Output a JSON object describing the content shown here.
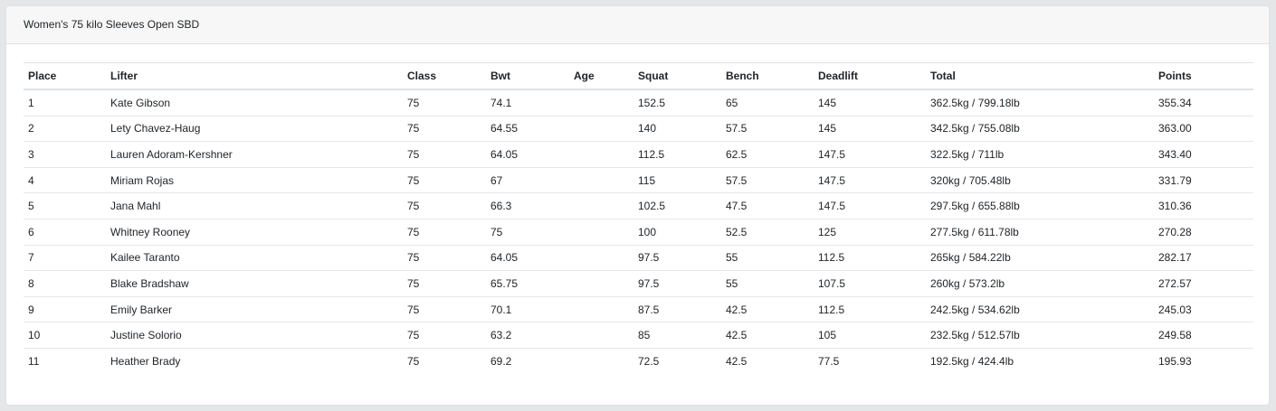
{
  "card": {
    "title": "Women's 75 kilo Sleeves Open SBD"
  },
  "table": {
    "headers": {
      "place": "Place",
      "lifter": "Lifter",
      "class": "Class",
      "bwt": "Bwt",
      "age": "Age",
      "squat": "Squat",
      "bench": "Bench",
      "deadlift": "Deadlift",
      "total": "Total",
      "points": "Points"
    },
    "rows": [
      {
        "place": "1",
        "lifter": "Kate Gibson",
        "class": "75",
        "bwt": "74.1",
        "age": "",
        "squat": "152.5",
        "bench": "65",
        "deadlift": "145",
        "total": "362.5kg / 799.18lb",
        "points": "355.34"
      },
      {
        "place": "2",
        "lifter": "Lety Chavez-Haug",
        "class": "75",
        "bwt": "64.55",
        "age": "",
        "squat": "140",
        "bench": "57.5",
        "deadlift": "145",
        "total": "342.5kg / 755.08lb",
        "points": "363.00"
      },
      {
        "place": "3",
        "lifter": "Lauren Adoram-Kershner",
        "class": "75",
        "bwt": "64.05",
        "age": "",
        "squat": "112.5",
        "bench": "62.5",
        "deadlift": "147.5",
        "total": "322.5kg / 711lb",
        "points": "343.40"
      },
      {
        "place": "4",
        "lifter": "Miriam Rojas",
        "class": "75",
        "bwt": "67",
        "age": "",
        "squat": "115",
        "bench": "57.5",
        "deadlift": "147.5",
        "total": "320kg / 705.48lb",
        "points": "331.79"
      },
      {
        "place": "5",
        "lifter": "Jana Mahl",
        "class": "75",
        "bwt": "66.3",
        "age": "",
        "squat": "102.5",
        "bench": "47.5",
        "deadlift": "147.5",
        "total": "297.5kg / 655.88lb",
        "points": "310.36"
      },
      {
        "place": "6",
        "lifter": "Whitney Rooney",
        "class": "75",
        "bwt": "75",
        "age": "",
        "squat": "100",
        "bench": "52.5",
        "deadlift": "125",
        "total": "277.5kg / 611.78lb",
        "points": "270.28"
      },
      {
        "place": "7",
        "lifter": "Kailee Taranto",
        "class": "75",
        "bwt": "64.05",
        "age": "",
        "squat": "97.5",
        "bench": "55",
        "deadlift": "112.5",
        "total": "265kg / 584.22lb",
        "points": "282.17"
      },
      {
        "place": "8",
        "lifter": "Blake Bradshaw",
        "class": "75",
        "bwt": "65.75",
        "age": "",
        "squat": "97.5",
        "bench": "55",
        "deadlift": "107.5",
        "total": "260kg / 573.2lb",
        "points": "272.57"
      },
      {
        "place": "9",
        "lifter": "Emily Barker",
        "class": "75",
        "bwt": "70.1",
        "age": "",
        "squat": "87.5",
        "bench": "42.5",
        "deadlift": "112.5",
        "total": "242.5kg / 534.62lb",
        "points": "245.03"
      },
      {
        "place": "10",
        "lifter": "Justine Solorio",
        "class": "75",
        "bwt": "63.2",
        "age": "",
        "squat": "85",
        "bench": "42.5",
        "deadlift": "105",
        "total": "232.5kg / 512.57lb",
        "points": "249.58"
      },
      {
        "place": "11",
        "lifter": "Heather Brady",
        "class": "75",
        "bwt": "69.2",
        "age": "",
        "squat": "72.5",
        "bench": "42.5",
        "deadlift": "77.5",
        "total": "192.5kg / 424.4lb",
        "points": "195.93"
      }
    ]
  }
}
